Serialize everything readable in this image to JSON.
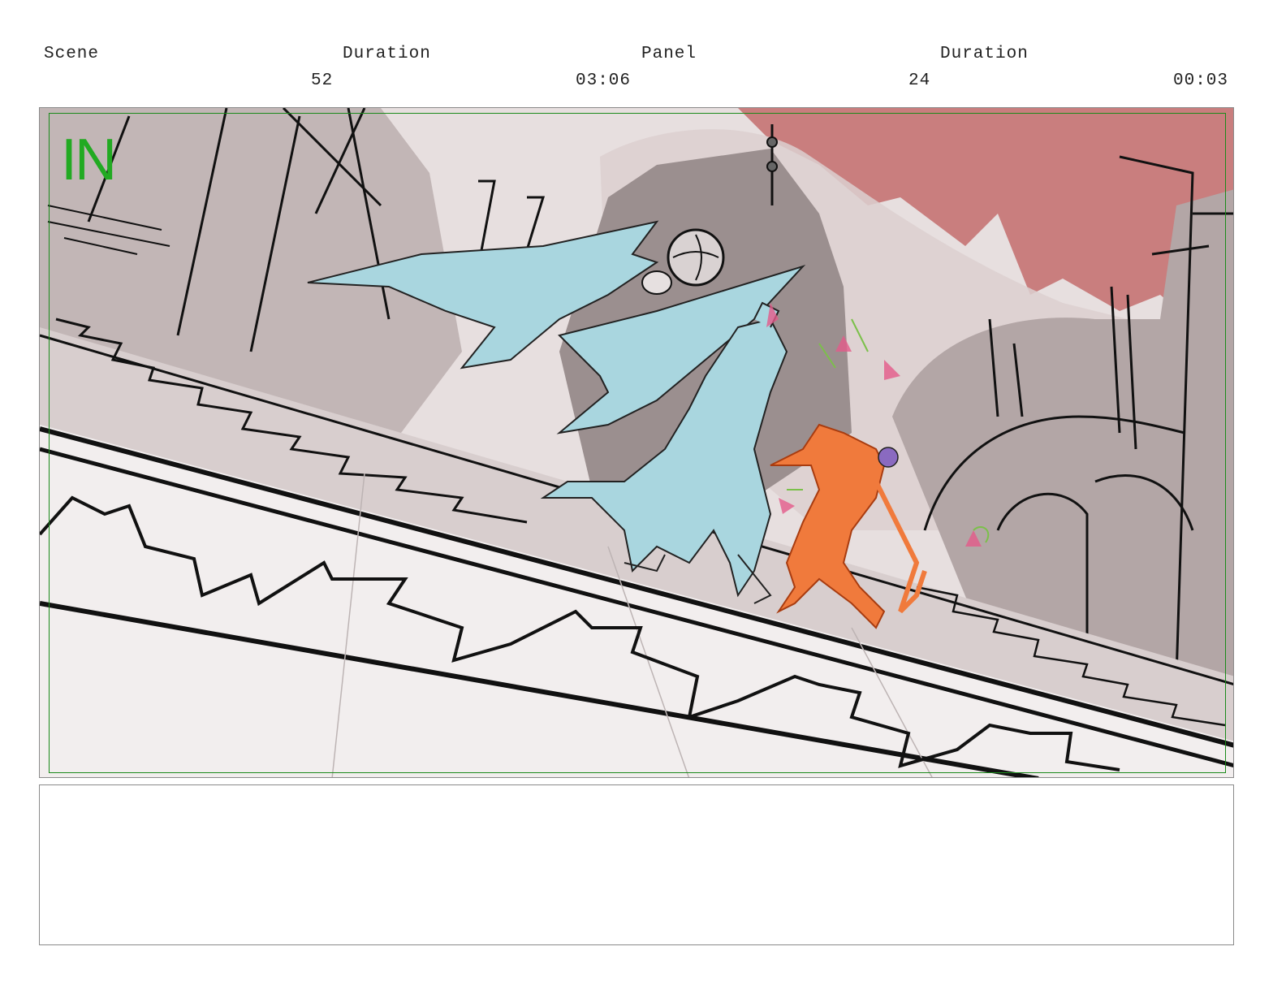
{
  "header": {
    "scene_label": "Scene",
    "scene_duration_label": "Duration",
    "panel_label": "Panel",
    "panel_duration_label": "Duration",
    "scene_value": "52",
    "scene_duration_value": "03:06",
    "panel_value": "24",
    "panel_duration_value": "00:03"
  },
  "panel": {
    "overlay_text": "IN",
    "overlay_color": "#22aa22",
    "safe_area_color": "#1b8a1b"
  },
  "colors": {
    "sky": "#c97e7e",
    "blue_character": "#a9d6df",
    "orange_character": "#f07a3c",
    "ink": "#111111"
  },
  "notes": {
    "text": ""
  }
}
